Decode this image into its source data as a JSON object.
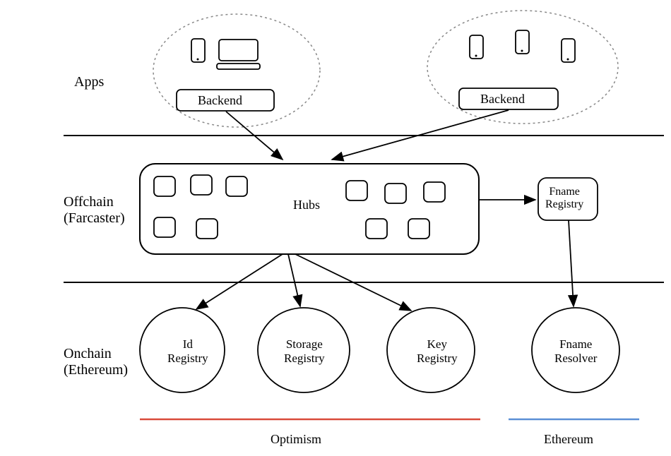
{
  "sections": {
    "apps": "Apps",
    "offchain": "Offchain\n(Farcaster)",
    "onchain": "Onchain\n(Ethereum)"
  },
  "backends": {
    "left": "Backend",
    "right": "Backend"
  },
  "hubs": "Hubs",
  "fname_registry": "Fname\nRegistry",
  "registries": {
    "id": "Id\nRegistry",
    "storage": "Storage\nRegistry",
    "key": "Key\nRegistry"
  },
  "fname_resolver": "Fname\nResolver",
  "chains": {
    "optimism": "Optimism",
    "ethereum": "Ethereum"
  },
  "colors": {
    "optimism": "#d94a3a",
    "ethereum": "#5b8fd6"
  }
}
